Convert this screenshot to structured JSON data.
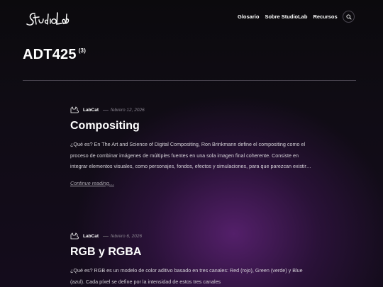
{
  "brand": {
    "logo_text": "StudioLab"
  },
  "nav": {
    "items": [
      "Glosario",
      "Sobre StudioLab",
      "Recursos"
    ]
  },
  "archive": {
    "title": "ADT425",
    "count": "(3)"
  },
  "posts": [
    {
      "author": "LabCat",
      "date": "febrero 12, 2026",
      "title": "Compositing",
      "excerpt": "¿Qué es? En The Art and Science of Digital Compositing, Ron Brinkmann define el compositing como el proceso de combinar imágenes de múltiples fuentes en una sola imagen final coherente. Consiste en integrar elementos visuales, como personajes, fondos, efectos y simulaciones, para que parezcan existir…",
      "more": "Continue reading…"
    },
    {
      "author": "LabCat",
      "date": "febrero 6, 2026",
      "title": "RGB y RGBA",
      "excerpt": "¿Qué es? RGB es un modelo de color aditivo basado en tres canales: Red (rojo), Green (verde) y Blue (azul). Cada píxel se define por la intensidad de estos tres canales"
    }
  ]
}
